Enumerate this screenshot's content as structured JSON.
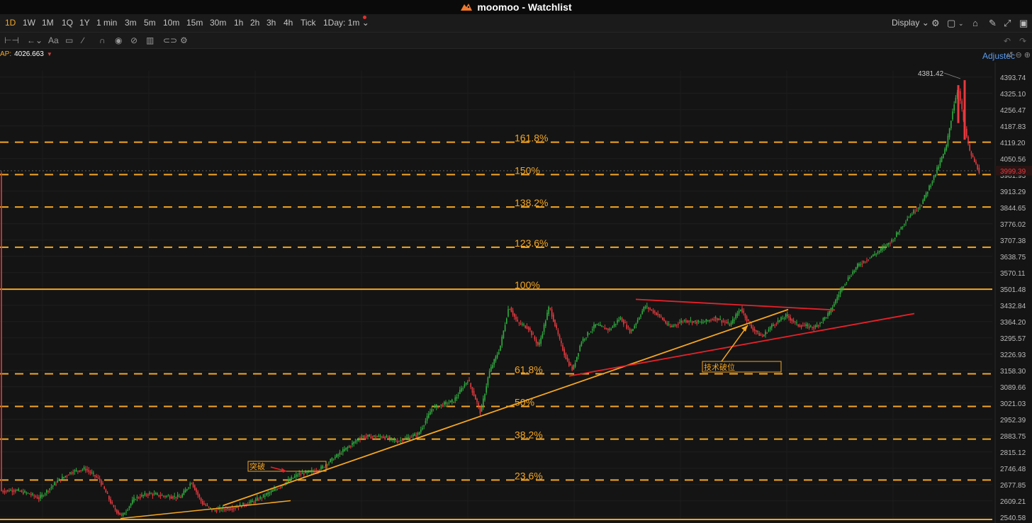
{
  "window": {
    "title": "moomoo - Watchlist"
  },
  "timeframes": [
    "1D",
    "1W",
    "1M",
    "1Q",
    "1Y",
    "1 min",
    "3m",
    "5m",
    "10m",
    "15m",
    "30m",
    "1h",
    "2h",
    "3h",
    "4h",
    "Tick"
  ],
  "active_timeframe": "1D",
  "range_selector": "1Day: 1m",
  "display_label": "Display",
  "indicator": {
    "label": "AP:",
    "value": "4026.663"
  },
  "adjust_label": "Adjustec",
  "colors": {
    "up": "#2fae3f",
    "down": "#e8393f",
    "fib": "#f5a623",
    "trend_red": "#e8212a",
    "bg": "#141414"
  },
  "chart_data": {
    "type": "candlestick",
    "y_ticks": [
      "4393.74",
      "4325.10",
      "4256.47",
      "4187.83",
      "4119.20",
      "4050.56",
      "3981.93",
      "3913.29",
      "3844.65",
      "3776.02",
      "3707.38",
      "3638.75",
      "3570.11",
      "3501.48",
      "3432.84",
      "3364.20",
      "3295.57",
      "3226.93",
      "3158.30",
      "3089.66",
      "3021.03",
      "2952.39",
      "2883.75",
      "2815.12",
      "2746.48",
      "2677.85",
      "2609.21",
      "2540.58"
    ],
    "ylim": [
      2528,
      4420
    ],
    "last_price": "3999.39",
    "high_label": "4381.42",
    "fib_levels": [
      {
        "label": "161.8%",
        "price": 4119.8,
        "style": "dashed"
      },
      {
        "label": "150%",
        "price": 3983.2,
        "style": "dashed"
      },
      {
        "label": "138.2%",
        "price": 3846.5,
        "style": "dashed"
      },
      {
        "label": "123.6%",
        "price": 3677.4,
        "style": "dashed"
      },
      {
        "label": "100%",
        "price": 3500.5,
        "style": "solid"
      },
      {
        "label": "61.8%",
        "price": 3144.3,
        "style": "dashed"
      },
      {
        "label": "50%",
        "price": 3006.8,
        "style": "dashed"
      },
      {
        "label": "38.2%",
        "price": 2869.2,
        "style": "dashed"
      },
      {
        "label": "23.6%",
        "price": 2697.0,
        "style": "dashed"
      },
      {
        "label": "",
        "price": 2531.0,
        "style": "solid"
      }
    ],
    "annotations": [
      {
        "text": "突破"
      },
      {
        "text": "技术破位"
      }
    ],
    "close_path": [
      [
        0,
        2650
      ],
      [
        20,
        2655
      ],
      [
        40,
        2640
      ],
      [
        55,
        2620
      ],
      [
        80,
        2690
      ],
      [
        100,
        2730
      ],
      [
        120,
        2745
      ],
      [
        140,
        2700
      ],
      [
        160,
        2580
      ],
      [
        172,
        2545
      ],
      [
        190,
        2620
      ],
      [
        210,
        2640
      ],
      [
        230,
        2630
      ],
      [
        255,
        2625
      ],
      [
        270,
        2690
      ],
      [
        285,
        2600
      ],
      [
        300,
        2570
      ],
      [
        330,
        2580
      ],
      [
        360,
        2610
      ],
      [
        390,
        2660
      ],
      [
        420,
        2720
      ],
      [
        450,
        2740
      ],
      [
        480,
        2810
      ],
      [
        510,
        2880
      ],
      [
        540,
        2880
      ],
      [
        560,
        2860
      ],
      [
        590,
        2890
      ],
      [
        610,
        3000
      ],
      [
        640,
        3030
      ],
      [
        660,
        3120
      ],
      [
        672,
        3030
      ],
      [
        678,
        2980
      ],
      [
        690,
        3150
      ],
      [
        705,
        3250
      ],
      [
        718,
        3430
      ],
      [
        730,
        3360
      ],
      [
        745,
        3340
      ],
      [
        760,
        3260
      ],
      [
        775,
        3430
      ],
      [
        790,
        3280
      ],
      [
        800,
        3200
      ],
      [
        808,
        3160
      ],
      [
        820,
        3280
      ],
      [
        840,
        3350
      ],
      [
        860,
        3330
      ],
      [
        875,
        3380
      ],
      [
        890,
        3320
      ],
      [
        910,
        3430
      ],
      [
        930,
        3390
      ],
      [
        945,
        3340
      ],
      [
        965,
        3370
      ],
      [
        990,
        3360
      ],
      [
        1010,
        3380
      ],
      [
        1030,
        3350
      ],
      [
        1045,
        3420
      ],
      [
        1060,
        3340
      ],
      [
        1075,
        3300
      ],
      [
        1090,
        3350
      ],
      [
        1110,
        3390
      ],
      [
        1125,
        3350
      ],
      [
        1150,
        3340
      ],
      [
        1170,
        3400
      ],
      [
        1190,
        3520
      ],
      [
        1210,
        3600
      ],
      [
        1240,
        3660
      ],
      [
        1260,
        3710
      ],
      [
        1280,
        3800
      ],
      [
        1300,
        3860
      ],
      [
        1320,
        3990
      ],
      [
        1335,
        4100
      ],
      [
        1345,
        4270
      ],
      [
        1352,
        4350
      ],
      [
        1360,
        4200
      ],
      [
        1368,
        4080
      ],
      [
        1376,
        4030
      ],
      [
        1383,
        3990
      ]
    ]
  }
}
